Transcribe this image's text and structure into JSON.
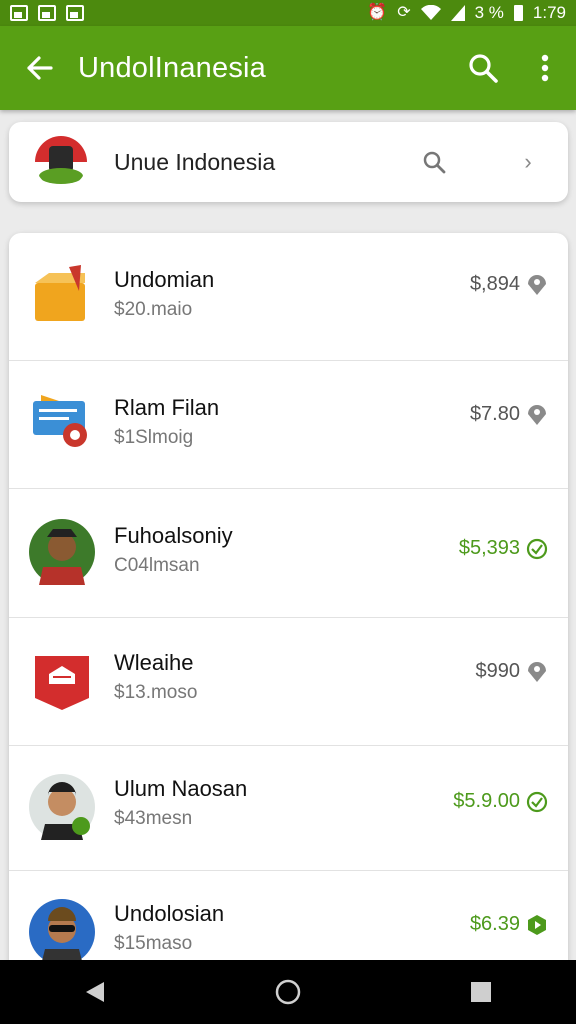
{
  "status_bar": {
    "battery_text": "3 %",
    "time": "1:79"
  },
  "app_bar": {
    "title": "UndolInanesia"
  },
  "header_card": {
    "label": "Unue Indonesia"
  },
  "rows": [
    {
      "name": "Undomian",
      "sub": "$20.maio",
      "amount": "$,894",
      "status": "grey"
    },
    {
      "name": "Rlam Filan",
      "sub": "$1Slmoig",
      "amount": "$7.80",
      "status": "grey"
    },
    {
      "name": "Fuhoalsoniy",
      "sub": "C04lmsan",
      "amount": "$5,393",
      "status": "green"
    },
    {
      "name": "Wleaihe",
      "sub": "$13.moso",
      "amount": "$990",
      "status": "grey"
    },
    {
      "name": "Ulum Naosan",
      "sub": "$43mesn",
      "amount": "$5.9.00",
      "status": "green"
    },
    {
      "name": "Undolosian",
      "sub": "$15maso",
      "amount": "$6.39",
      "status": "green"
    }
  ],
  "colors": {
    "status_bar": "#4c8a0e",
    "app_bar": "#58a014",
    "accent_green": "#4d9a1c"
  }
}
